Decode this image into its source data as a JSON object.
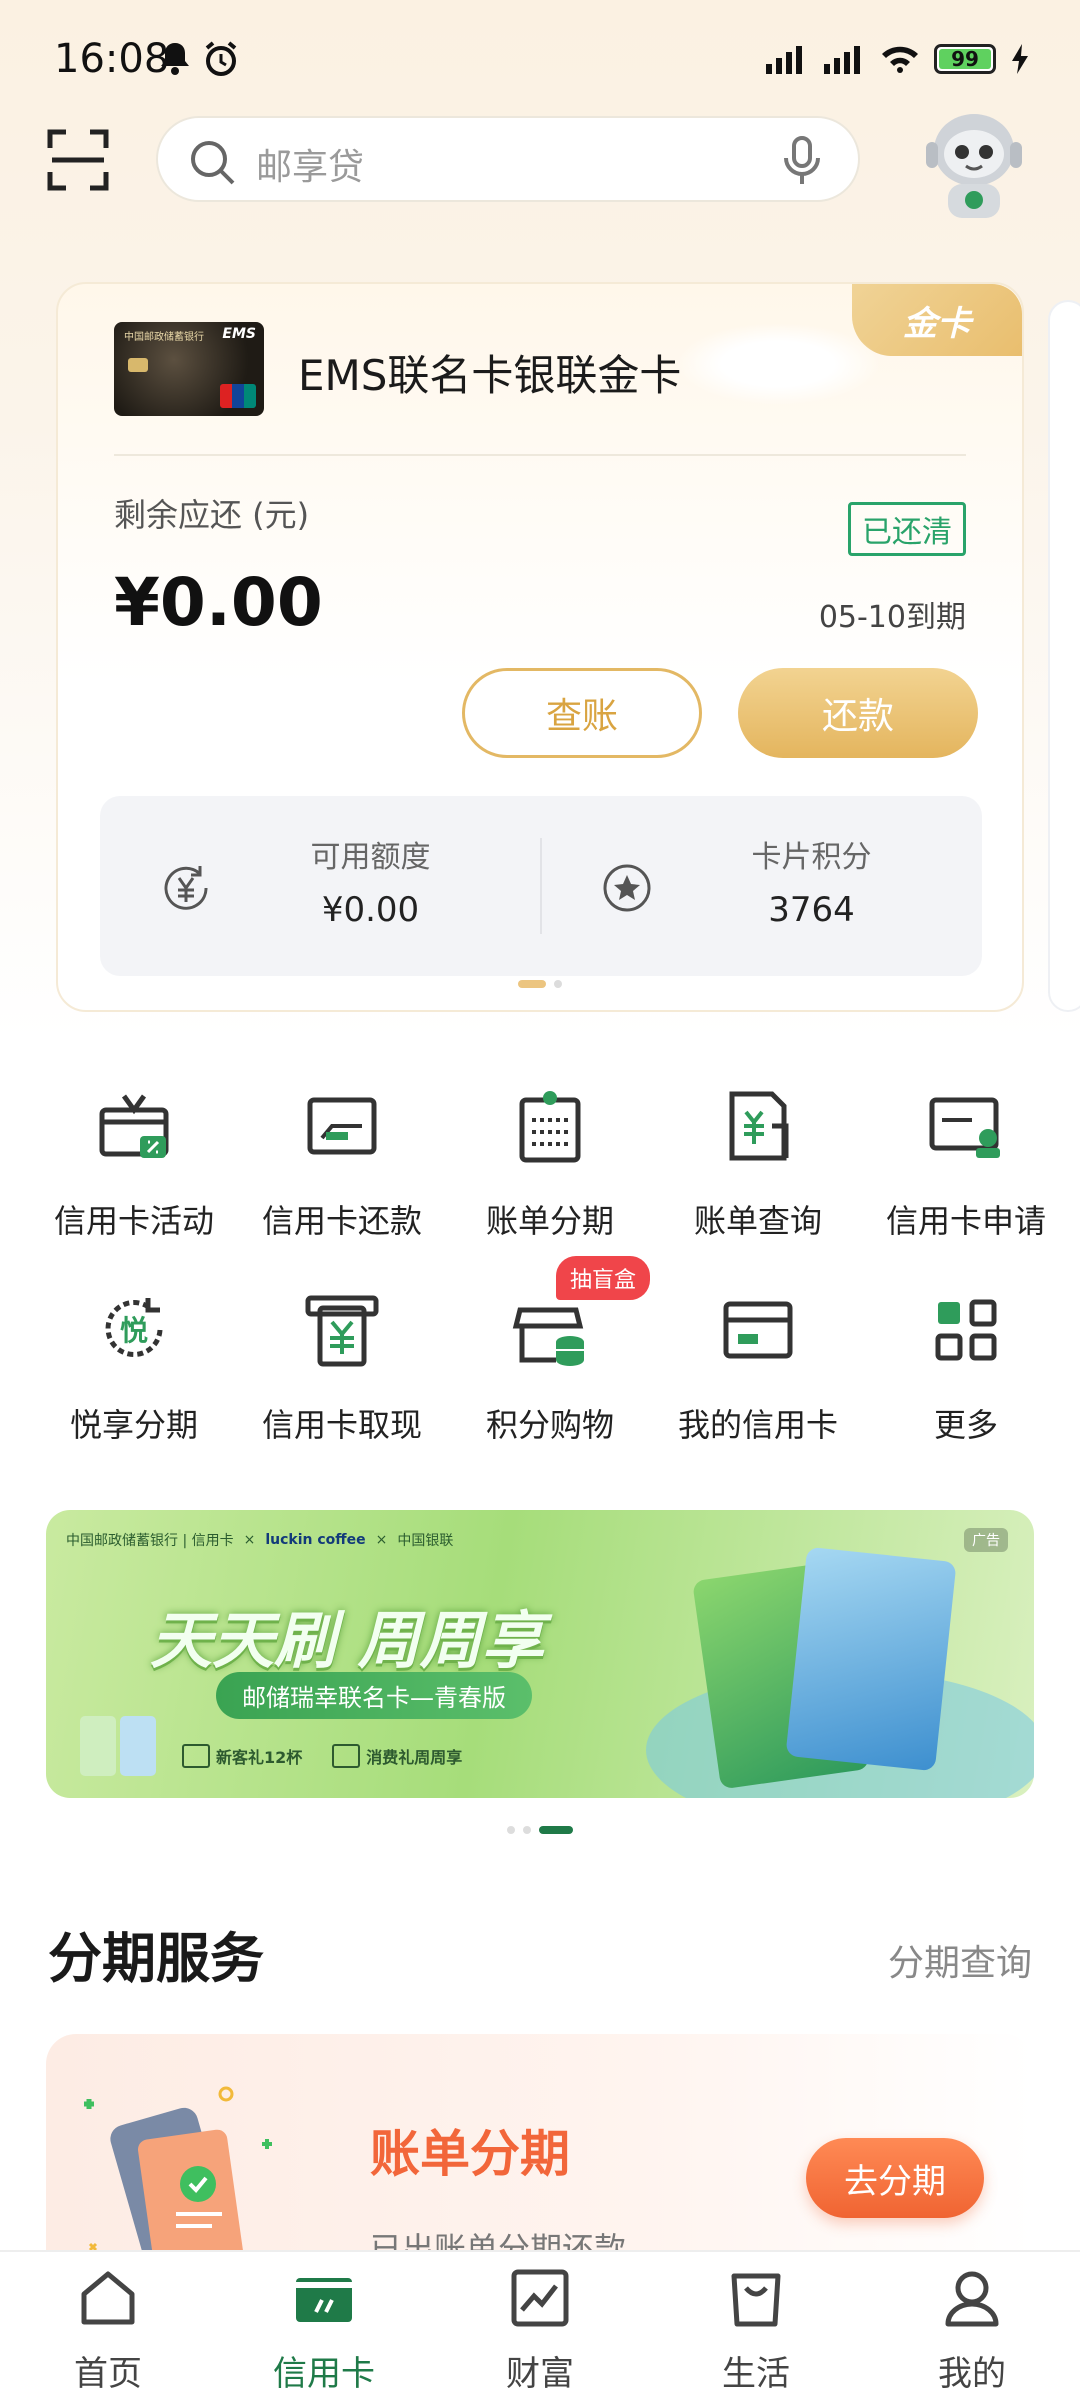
{
  "status_bar": {
    "time": "16:08",
    "battery": "99"
  },
  "search": {
    "placeholder": "邮享贷"
  },
  "card": {
    "tier_tag": "金卡",
    "name": "EMS联名卡银联金卡",
    "remaining_label": "剩余应还 (元)",
    "status_badge": "已还清",
    "amount_due": "¥0.00",
    "due_date": "05-10",
    "due_suffix": "到期",
    "statement_button": "查账",
    "repay_button": "还款",
    "available_limit_label": "可用额度",
    "available_limit_value": "¥0.00",
    "points_label": "卡片积分",
    "points_value": "3764",
    "thumb_brand": "EMS",
    "thumb_bank": "中国邮政储蓄银行"
  },
  "quick_actions": [
    {
      "label": "信用卡活动",
      "icon": "gift-card-icon"
    },
    {
      "label": "信用卡还款",
      "icon": "repay-card-icon"
    },
    {
      "label": "账单分期",
      "icon": "bill-installment-icon"
    },
    {
      "label": "账单查询",
      "icon": "bill-query-icon"
    },
    {
      "label": "信用卡申请",
      "icon": "card-apply-icon"
    },
    {
      "label": "悦享分期",
      "icon": "yue-installment-icon"
    },
    {
      "label": "信用卡取现",
      "icon": "cash-withdraw-icon"
    },
    {
      "label": "积分购物",
      "icon": "points-shop-icon",
      "badge": "抽盲盒"
    },
    {
      "label": "我的信用卡",
      "icon": "my-card-icon"
    },
    {
      "label": "更多",
      "icon": "more-grid-icon"
    }
  ],
  "banner": {
    "bank": "中国邮政储蓄银行 | 信用卡",
    "partner": "luckin coffee",
    "union": "中国银联",
    "ad_tag": "广告",
    "slogan": "天天刷 周周享",
    "subtitle": "邮储瑞幸联名卡—青春版",
    "gift_1": "新客礼12杯",
    "gift_2": "消费礼周周享"
  },
  "installment": {
    "section_title": "分期服务",
    "section_link": "分期查询",
    "card_title": "账单分期",
    "card_desc": "已出账单分期还款",
    "card_button": "去分期"
  },
  "bottom_nav": [
    {
      "label": "首页",
      "icon": "home-icon"
    },
    {
      "label": "信用卡",
      "icon": "credit-card-icon"
    },
    {
      "label": "财富",
      "icon": "wealth-chart-icon"
    },
    {
      "label": "生活",
      "icon": "shopping-bag-icon"
    },
    {
      "label": "我的",
      "icon": "profile-icon"
    }
  ],
  "colors": {
    "accent_green": "#1f7a48",
    "gold": "#e4b55e",
    "paid_green": "#29a36a",
    "orange": "#f06432"
  }
}
